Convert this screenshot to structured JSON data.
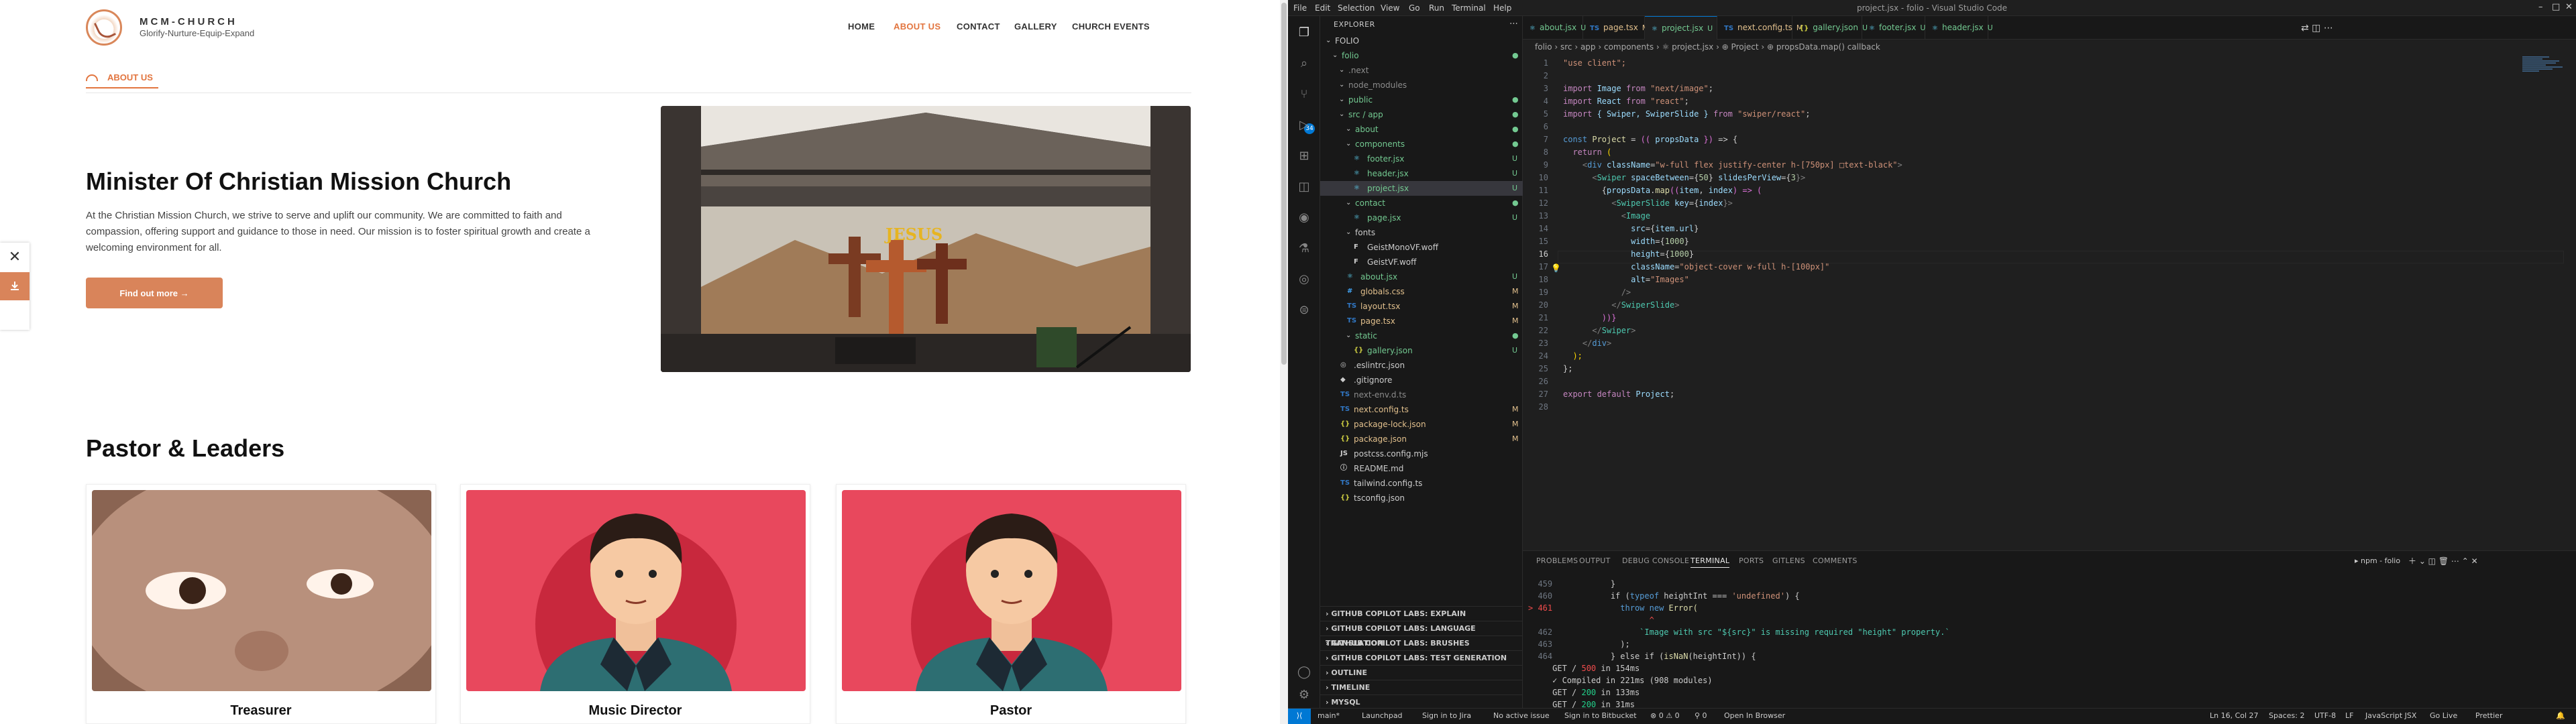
{
  "site": {
    "brand": {
      "name": "MCM-CHURCH",
      "tagline": "Glorify-Nurture-Equip-Expand"
    },
    "nav": [
      "HOME",
      "ABOUT US",
      "CONTACT",
      "GALLERY",
      "CHURCH EVENTS"
    ],
    "page_label": "ABOUT US",
    "hero": {
      "title": "Minister Of Christian Mission Church",
      "text": "At the Christian Mission Church, we strive to serve and uplift our community. We are committed to faith and compassion, offering support and guidance to those in need. Our mission is to foster spiritual growth and create a welcoming environment for all.",
      "button": "Find out more →",
      "image_sign": "JESUS"
    },
    "side_close": "✕",
    "section_title": "Pastor & Leaders",
    "leaders": [
      {
        "title": "Treasurer"
      },
      {
        "title": "Music Director"
      },
      {
        "title": "Pastor"
      }
    ]
  },
  "vscode": {
    "menu": [
      "File",
      "Edit",
      "Selection",
      "View",
      "Go",
      "Run",
      "Terminal",
      "Help"
    ],
    "window_title": "project.jsx - folio - Visual Studio Code",
    "explorer_title": "EXPLORER",
    "tree": [
      {
        "d": 0,
        "k": "chev",
        "i": "",
        "n": "FOLIO",
        "s": "",
        "c": "#ccc"
      },
      {
        "d": 1,
        "k": "chev",
        "i": "",
        "n": "folio",
        "s": "●",
        "c": "#73c991"
      },
      {
        "d": 2,
        "k": "chev",
        "i": "",
        "n": ".next",
        "s": "",
        "c": "#8c8c8c"
      },
      {
        "d": 2,
        "k": "chev",
        "i": "",
        "n": "node_modules",
        "s": "",
        "c": "#8c8c8c"
      },
      {
        "d": 2,
        "k": "chev",
        "i": "",
        "n": "public",
        "s": "●",
        "c": "#73c991"
      },
      {
        "d": 2,
        "k": "chev",
        "i": "",
        "n": "src / app",
        "s": "●",
        "c": "#73c991"
      },
      {
        "d": 3,
        "k": "chev",
        "i": "",
        "n": "about",
        "s": "●",
        "c": "#73c991"
      },
      {
        "d": 3,
        "k": "chev",
        "i": "",
        "n": "components",
        "s": "●",
        "c": "#73c991"
      },
      {
        "d": 4,
        "k": "file",
        "i": "⚛",
        "n": "footer.jsx",
        "s": "U",
        "c": "#73c991"
      },
      {
        "d": 4,
        "k": "file",
        "i": "⚛",
        "n": "header.jsx",
        "s": "U",
        "c": "#73c991"
      },
      {
        "d": 4,
        "k": "file",
        "i": "⚛",
        "n": "project.jsx",
        "s": "U",
        "c": "#73c991",
        "sel": true
      },
      {
        "d": 3,
        "k": "chev",
        "i": "",
        "n": "contact",
        "s": "●",
        "c": "#73c991"
      },
      {
        "d": 4,
        "k": "file",
        "i": "⚛",
        "n": "page.jsx",
        "s": "U",
        "c": "#73c991"
      },
      {
        "d": 3,
        "k": "chev",
        "i": "",
        "n": "fonts",
        "s": "",
        "c": "#ccc"
      },
      {
        "d": 4,
        "k": "file",
        "i": "F",
        "n": "GeistMonoVF.woff",
        "s": "",
        "c": "#ccc"
      },
      {
        "d": 4,
        "k": "file",
        "i": "F",
        "n": "GeistVF.woff",
        "s": "",
        "c": "#ccc"
      },
      {
        "d": 3,
        "k": "file",
        "i": "⚛",
        "n": "about.jsx",
        "s": "U",
        "c": "#73c991"
      },
      {
        "d": 3,
        "k": "file",
        "i": "#",
        "n": "globals.css",
        "s": "M",
        "c": "#e2c08d"
      },
      {
        "d": 3,
        "k": "file",
        "i": "TS",
        "n": "layout.tsx",
        "s": "M",
        "c": "#e2c08d"
      },
      {
        "d": 3,
        "k": "file",
        "i": "TS",
        "n": "page.tsx",
        "s": "M",
        "c": "#e2c08d"
      },
      {
        "d": 3,
        "k": "chev",
        "i": "",
        "n": "static",
        "s": "●",
        "c": "#73c991"
      },
      {
        "d": 4,
        "k": "file",
        "i": "{}",
        "n": "gallery.json",
        "s": "U",
        "c": "#73c991"
      },
      {
        "d": 2,
        "k": "file",
        "i": "◎",
        "n": ".eslintrc.json",
        "s": "",
        "c": "#ccc"
      },
      {
        "d": 2,
        "k": "file",
        "i": "◆",
        "n": ".gitignore",
        "s": "",
        "c": "#ccc"
      },
      {
        "d": 2,
        "k": "file",
        "i": "TS",
        "n": "next-env.d.ts",
        "s": "",
        "c": "#8c8c8c"
      },
      {
        "d": 2,
        "k": "file",
        "i": "TS",
        "n": "next.config.ts",
        "s": "M",
        "c": "#e2c08d"
      },
      {
        "d": 2,
        "k": "file",
        "i": "{}",
        "n": "package-lock.json",
        "s": "M",
        "c": "#e2c08d"
      },
      {
        "d": 2,
        "k": "file",
        "i": "{}",
        "n": "package.json",
        "s": "M",
        "c": "#e2c08d"
      },
      {
        "d": 2,
        "k": "file",
        "i": "JS",
        "n": "postcss.config.mjs",
        "s": "",
        "c": "#ccc"
      },
      {
        "d": 2,
        "k": "file",
        "i": "ⓘ",
        "n": "README.md",
        "s": "",
        "c": "#ccc"
      },
      {
        "d": 2,
        "k": "file",
        "i": "TS",
        "n": "tailwind.config.ts",
        "s": "",
        "c": "#ccc"
      },
      {
        "d": 2,
        "k": "file",
        "i": "{}",
        "n": "tsconfig.json",
        "s": "",
        "c": "#ccc"
      }
    ],
    "panel_sections": [
      "GITHUB COPILOT LABS: EXPLAIN",
      "GITHUB COPILOT LABS: LANGUAGE TRANSLATION",
      "GITHUB COPILOT LABS: BRUSHES",
      "GITHUB COPILOT LABS: TEST GENERATION",
      "OUTLINE",
      "TIMELINE",
      "MYSQL"
    ],
    "tabs": [
      {
        "icon": "⚛",
        "name": "about.jsx",
        "mark": "U",
        "c": "#73c991"
      },
      {
        "icon": "TS",
        "name": "page.tsx",
        "mark": "M",
        "c": "#e2c08d"
      },
      {
        "icon": "⚛",
        "name": "project.jsx",
        "mark": "U",
        "c": "#73c991",
        "active": true
      },
      {
        "icon": "TS",
        "name": "next.config.ts",
        "mark": "M",
        "c": "#e2c08d"
      },
      {
        "icon": "{}",
        "name": "gallery.json",
        "mark": "U",
        "c": "#73c991"
      },
      {
        "icon": "⚛",
        "name": "footer.jsx",
        "mark": "U",
        "c": "#73c991"
      },
      {
        "icon": "⚛",
        "name": "header.jsx",
        "mark": "U",
        "c": "#73c991"
      }
    ],
    "breadcrumbs": "folio  ›  src  ›  app  ›  components  ›  ⚛ project.jsx  ›  ⊕ Project  ›  ⊕ propsData.map() callback",
    "code": [
      [
        [
          "\"use client\";",
          "#ce9178"
        ]
      ],
      [],
      [
        [
          "import ",
          "#c586c0"
        ],
        [
          "Image ",
          "#9cdcfe"
        ],
        [
          "from ",
          "#c586c0"
        ],
        [
          "\"next/image\"",
          "#ce9178"
        ],
        [
          ";",
          "#ccc"
        ]
      ],
      [
        [
          "import ",
          "#c586c0"
        ],
        [
          "React ",
          "#9cdcfe"
        ],
        [
          "from ",
          "#c586c0"
        ],
        [
          "\"react\"",
          "#ce9178"
        ],
        [
          ";",
          "#ccc"
        ]
      ],
      [
        [
          "import ",
          "#c586c0"
        ],
        [
          "{ Swiper, SwiperSlide } ",
          "#9cdcfe"
        ],
        [
          "from ",
          "#c586c0"
        ],
        [
          "\"swiper/react\"",
          "#ce9178"
        ],
        [
          ";",
          "#ccc"
        ]
      ],
      [],
      [
        [
          "const ",
          "#569cd6"
        ],
        [
          "Project ",
          "#dcdcaa"
        ],
        [
          "= ",
          "#ccc"
        ],
        [
          "(( ",
          "#da70d6"
        ],
        [
          "propsData ",
          "#9cdcfe"
        ],
        [
          "}) ",
          "#da70d6"
        ],
        [
          "=> {",
          "#ccc"
        ]
      ],
      [
        [
          "  return ",
          "#c586c0"
        ],
        [
          "(",
          "#ffd700"
        ]
      ],
      [
        [
          "    <",
          "#808080"
        ],
        [
          "div ",
          "#569cd6"
        ],
        [
          "className",
          "#9cdcfe"
        ],
        [
          "=",
          "#ccc"
        ],
        [
          "\"w-full flex justify-center h-[750px] □text-black\"",
          "#ce9178"
        ],
        [
          ">",
          "#808080"
        ]
      ],
      [
        [
          "      <",
          "#808080"
        ],
        [
          "Swiper ",
          "#4ec9b0"
        ],
        [
          "spaceBetween",
          "#9cdcfe"
        ],
        [
          "={",
          "#ccc"
        ],
        [
          "50",
          "#b5cea8"
        ],
        [
          "} ",
          "#ccc"
        ],
        [
          "slidesPerView",
          "#9cdcfe"
        ],
        [
          "={",
          "#ccc"
        ],
        [
          "3",
          "#b5cea8"
        ],
        [
          "}>",
          "#808080"
        ]
      ],
      [
        [
          "        {",
          "#ccc"
        ],
        [
          "propsData",
          "#9cdcfe"
        ],
        [
          ".",
          "#ccc"
        ],
        [
          "map",
          "#dcdcaa"
        ],
        [
          "((",
          "#da70d6"
        ],
        [
          "item",
          "#9cdcfe"
        ],
        [
          ", ",
          "#ccc"
        ],
        [
          "index",
          "#9cdcfe"
        ],
        [
          ") => (",
          "#da70d6"
        ]
      ],
      [
        [
          "          <",
          "#808080"
        ],
        [
          "SwiperSlide ",
          "#4ec9b0"
        ],
        [
          "key",
          "#9cdcfe"
        ],
        [
          "={",
          "#ccc"
        ],
        [
          "index",
          "#9cdcfe"
        ],
        [
          "}>",
          "#808080"
        ]
      ],
      [
        [
          "            <",
          "#808080"
        ],
        [
          "Image",
          "#4ec9b0"
        ]
      ],
      [
        [
          "              src",
          "#9cdcfe"
        ],
        [
          "={",
          "#ccc"
        ],
        [
          "item",
          "#9cdcfe"
        ],
        [
          ".",
          "#ccc"
        ],
        [
          "url",
          "#9cdcfe"
        ],
        [
          "}",
          "#ccc"
        ]
      ],
      [
        [
          "              width",
          "#9cdcfe"
        ],
        [
          "={",
          "#ccc"
        ],
        [
          "1000",
          "#b5cea8"
        ],
        [
          "}",
          "#ccc"
        ]
      ],
      [
        [
          "              height",
          "#9cdcfe"
        ],
        [
          "={",
          "#ccc"
        ],
        [
          "1000",
          "#b5cea8"
        ],
        [
          "}",
          "#ccc"
        ]
      ],
      [
        [
          "              className",
          "#9cdcfe"
        ],
        [
          "=",
          "#ccc"
        ],
        [
          "\"object-cover w-full h-[100px]\"",
          "#ce9178"
        ]
      ],
      [
        [
          "              alt",
          "#9cdcfe"
        ],
        [
          "=",
          "#ccc"
        ],
        [
          "\"Images\"",
          "#ce9178"
        ]
      ],
      [
        [
          "            />",
          "#808080"
        ]
      ],
      [
        [
          "          </",
          "#808080"
        ],
        [
          "SwiperSlide",
          "#4ec9b0"
        ],
        [
          ">",
          "#808080"
        ]
      ],
      [
        [
          "        ))}",
          "#da70d6"
        ]
      ],
      [
        [
          "      </",
          "#808080"
        ],
        [
          "Swiper",
          "#4ec9b0"
        ],
        [
          ">",
          "#808080"
        ]
      ],
      [
        [
          "    </",
          "#808080"
        ],
        [
          "div",
          "#569cd6"
        ],
        [
          ">",
          "#808080"
        ]
      ],
      [
        [
          "  );",
          "#ffd700"
        ]
      ],
      [
        [
          "};",
          "#ccc"
        ]
      ],
      [],
      [
        [
          "export ",
          "#c586c0"
        ],
        [
          "default ",
          "#c586c0"
        ],
        [
          "Project",
          "#9cdcfe"
        ],
        [
          ";",
          "#ccc"
        ]
      ],
      []
    ],
    "panel_tabs": [
      "PROBLEMS",
      "OUTPUT",
      "DEBUG CONSOLE",
      "TERMINAL",
      "PORTS",
      "GITLENS",
      "COMMENTS"
    ],
    "terminal_name": "▸ npm - folio",
    "terminal": [
      [
        [
          "459",
          "#6e7681"
        ],
        [
          "            }",
          "#ccc"
        ]
      ],
      [
        [
          "460",
          "#6e7681"
        ],
        [
          "            if (",
          "#ccc"
        ],
        [
          "typeof ",
          "#569cd6"
        ],
        [
          "heightInt === ",
          "#ccc"
        ],
        [
          "'undefined'",
          "#ce9178"
        ],
        [
          ") {",
          "#ccc"
        ]
      ],
      [
        [
          "> 461",
          "#f14c4c"
        ],
        [
          "              throw new ",
          "#569cd6"
        ],
        [
          "Error(",
          "#dcdcaa"
        ]
      ],
      [
        [
          "",
          "#ccc"
        ],
        [
          "                    ^",
          "#f14c4c"
        ]
      ],
      [
        [
          "462",
          "#6e7681"
        ],
        [
          "                  `Image with src \"${src}\" is missing required \"height\" property.`",
          "#4ec9b0"
        ]
      ],
      [
        [
          "463",
          "#6e7681"
        ],
        [
          "              );",
          "#ccc"
        ]
      ],
      [
        [
          "464",
          "#6e7681"
        ],
        [
          "            } else if (",
          "#ccc"
        ],
        [
          "isNaN",
          "#dcdcaa"
        ],
        [
          "(heightInt)) {",
          "#ccc"
        ]
      ],
      [
        [
          "",
          "#ccc"
        ],
        [
          "GET / ",
          "#ccc"
        ],
        [
          "500",
          "#f14c4c"
        ],
        [
          " in 154ms",
          "#ccc"
        ]
      ],
      [
        [
          "",
          "#ccc"
        ],
        [
          "✓ Compiled in 221ms (908 modules)",
          "#ccc"
        ]
      ],
      [
        [
          "",
          "#ccc"
        ],
        [
          "GET / ",
          "#ccc"
        ],
        [
          "200",
          "#23d18b"
        ],
        [
          " in 133ms",
          "#ccc"
        ]
      ],
      [
        [
          "",
          "#ccc"
        ],
        [
          "GET / ",
          "#ccc"
        ],
        [
          "200",
          "#23d18b"
        ],
        [
          " in 31ms",
          "#ccc"
        ]
      ],
      [
        [
          "",
          "#ccc"
        ],
        [
          "▯",
          "#ccc"
        ]
      ]
    ],
    "status": {
      "branch": "main*",
      "launchpad": "Launchpad",
      "jira": "Sign in to Jira",
      "issue": "No active issue",
      "bitbucket": "Sign in to Bitbucket",
      "problems": "⊗ 0 ⚠ 0",
      "ports": "⚲ 0",
      "browser": "Open In Browser",
      "position": "Ln 16, Col 27",
      "spaces": "Spaces: 2",
      "encoding": "UTF-8",
      "eol": "LF",
      "lang": "JavaScript JSX",
      "golive": "Go Live",
      "prettier": "Prettier"
    }
  },
  "colors": {
    "accent": "#e2753f",
    "button": "#d9845a",
    "vscode_blue": "#0078d4"
  }
}
